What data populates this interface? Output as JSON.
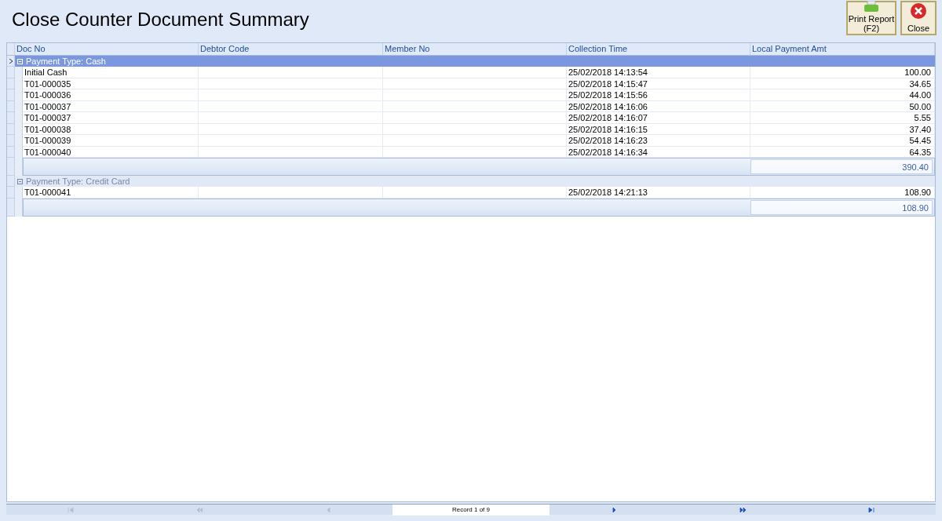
{
  "title": "Close Counter Document Summary",
  "toolbar": [
    {
      "kind": "print",
      "label": "Print Report",
      "shortcut": "(F2)"
    },
    {
      "kind": "close",
      "label": "Close"
    }
  ],
  "table": {
    "columns": [
      "Doc No",
      "Debtor Code",
      "Member No",
      "Collection Time",
      "Local Payment Amt"
    ],
    "groups": [
      {
        "label": "Payment Type: Cash",
        "selected": true,
        "expanded": true,
        "rows": [
          [
            "Initial Cash",
            "",
            "",
            "25/02/2018 14:13:54",
            "100.00"
          ],
          [
            "T01-000035",
            "",
            "",
            "25/02/2018 14:15:47",
            "34.65"
          ],
          [
            "T01-000036",
            "",
            "",
            "25/02/2018 14:15:56",
            "44.00"
          ],
          [
            "T01-000037",
            "",
            "",
            "25/02/2018 14:16:06",
            "50.00"
          ],
          [
            "T01-000037",
            "",
            "",
            "25/02/2018 14:16:07",
            "5.55"
          ],
          [
            "T01-000038",
            "",
            "",
            "25/02/2018 14:16:15",
            "37.40"
          ],
          [
            "T01-000039",
            "",
            "",
            "25/02/2018 14:16:23",
            "54.45"
          ],
          [
            "T01-000040",
            "",
            "",
            "25/02/2018 14:16:34",
            "64.35"
          ]
        ],
        "total": "390.40"
      },
      {
        "label": "Payment Type: Credit Card",
        "selected": false,
        "expanded": true,
        "rows": [
          [
            "T01-000041",
            "",
            "",
            "25/02/2018 14:21:13",
            "108.90"
          ]
        ],
        "total": "108.90"
      }
    ]
  },
  "navigator": {
    "record": "Record 1 of 9",
    "buttons": [
      {
        "kind": "first",
        "disabled": true
      },
      {
        "kind": "prev-page",
        "disabled": true
      },
      {
        "kind": "prev",
        "disabled": true
      },
      {
        "kind": "next",
        "disabled": false
      },
      {
        "kind": "next-page",
        "disabled": false
      },
      {
        "kind": "last",
        "disabled": false
      }
    ]
  }
}
